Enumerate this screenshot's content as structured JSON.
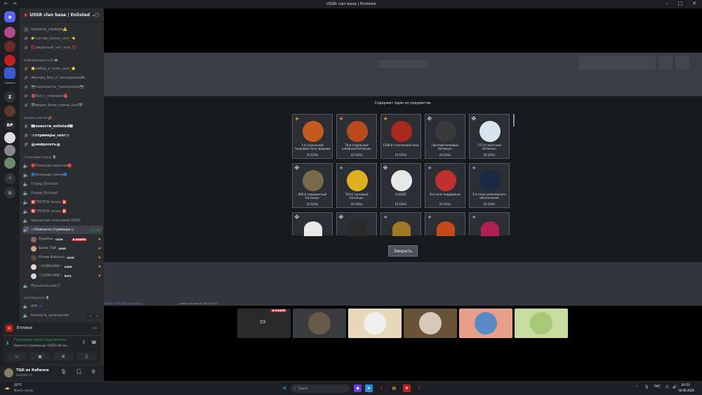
{
  "window": {
    "title": "USSR clan base | Enlisted",
    "nav": "←→"
  },
  "rail": {
    "servers_label": "Сервера"
  },
  "server": {
    "name": "USSR clan base | Enlisted"
  },
  "channels": {
    "top": [
      {
        "label": "правила_сервера⚠️"
      },
      {
        "label": "👉состав_клана_ussr_👈"
      },
      {
        "label": "🚫закрытый_чат_ussr_🚫"
      }
    ],
    "cat_info": "информационный 👁️",
    "info": [
      {
        "label": "🌟набор_в_клан_ussr_🌟"
      },
      {
        "label": "🎮инфа_бои_и_тренировки🎮"
      },
      {
        "label": "📷скриншоты_тренировок📷"
      },
      {
        "label": "📕бои_с_кланами📕"
      },
      {
        "label": "🎬видео_боев_клана_ussr🎬"
      }
    ],
    "cat_news": "всякие разное 🎉",
    "news": [
      {
        "label": "📰новости_enlisted📰"
      },
      {
        "label": "📹стримеры_ussr📹"
      },
      {
        "label": "🤖нейросеть🤖"
      }
    ],
    "cat_voice": "Голосовые Связь 🎙️",
    "voice": [
      {
        "label": "🔴Команда красная🔴"
      },
      {
        "label": "🔵Команда синяя🔵"
      },
      {
        "label": "Отряд Enlisted"
      },
      {
        "label": "Отряд Enlisted"
      },
      {
        "label": "🅰️ГРУППА точка 🅰️"
      },
      {
        "label": "🅱️ГРУППА точка 🅱️"
      },
      {
        "label": "Закрытый голосовой USSR"
      },
      {
        "label": "📹Комната стримера📹",
        "timer": "2:57:48"
      }
    ],
    "members": [
      {
        "name": "Лудобин",
        "tag": "USSR",
        "live": "В ЭФИРЕ"
      },
      {
        "name": "Бусик ТЦК",
        "tag": "USSR"
      },
      {
        "name": "Отчим Кабачка",
        "tag": "USSR"
      },
      {
        "name": "♡CHTACHOK♡",
        "tag": "USSR"
      },
      {
        "name": "♡CHTACHOK♡",
        "tag": "ROFL"
      }
    ],
    "music": "Музыкальный🎵",
    "cat_talk": "разговорная 🎙️",
    "talk": [
      {
        "label": "AFK 💤"
      },
      {
        "label": "Комната_выяснения",
        "counts": [
          "00",
          "02"
        ]
      }
    ]
  },
  "voicepanel": {
    "game": "Enlisted",
    "status": "Голосовая связь подключена",
    "location": "Комната стримера📹 / USSR clan ba..."
  },
  "user": {
    "name": "ТЦК из Кабачка",
    "status": "Enlisted +1"
  },
  "popup": {
    "title": "Содержит один из предметов:",
    "close_label": "Закрыть",
    "cards": [
      {
        "name": "1-й отдельный танковый полк прорыва",
        "pct": "(0.53%)",
        "rank": "★",
        "rank_color": "#e8a33a",
        "color": "#c45a1e"
      },
      {
        "name": "78-й отдельный сапёрный батальон",
        "pct": "(0.53%)",
        "rank": "★",
        "rank_color": "#e8a33a",
        "color": "#b84a1e"
      },
      {
        "name": "1180-й стрелковый полк",
        "pct": "(0.53%)",
        "rank": "★",
        "rank_color": "#e8a33a",
        "color": "#a8281e"
      },
      {
        "name": "противотанковый батальон",
        "pct": "(0.53%)",
        "rank": "✠",
        "rank_color": "#ffffff",
        "color": "#3a3a3a"
      },
      {
        "name": "157-й пехотный батальон",
        "pct": "(0.53%)",
        "rank": "✠",
        "rank_color": "#ffffff",
        "color": "#d8e4ee"
      },
      {
        "name": "600-й парашютный батальон",
        "pct": "(0.53%)",
        "rank": "✠",
        "rank_color": "#ffffff",
        "color": "#7a6a4a"
      },
      {
        "name": "743-й танковый батальон",
        "pct": "(0.53%)",
        "rank": "★",
        "rank_color": "#7aa6e0",
        "color": "#e0b020"
      },
      {
        "name": "III./JG26",
        "pct": "(0.53%)",
        "rank": "✠",
        "rank_color": "#ffffff",
        "color": "#e8e8e8"
      },
      {
        "name": "8-й полк поддержки",
        "pct": "(0.53%)",
        "rank": "★",
        "rank_color": "#7aa6e0",
        "color": "#c03030"
      },
      {
        "name": "2-й полк инженерного обеспечения",
        "pct": "(0.53%)",
        "rank": "★",
        "rank_color": "#7aa6e0",
        "color": "#1a2a44"
      },
      {
        "name": "",
        "pct": "",
        "rank": "✠",
        "rank_color": "#ffffff",
        "color": "#e8e8e8"
      },
      {
        "name": "",
        "pct": "",
        "rank": "✠",
        "rank_color": "#ffffff",
        "color": "#2a2a2a"
      },
      {
        "name": "",
        "pct": "",
        "rank": "★",
        "rank_color": "#7aa6e0",
        "color": "#a07828"
      },
      {
        "name": "",
        "pct": "",
        "rank": "★",
        "rank_color": "#7aa6e0",
        "color": "#c44a1e"
      },
      {
        "name": "",
        "pct": "",
        "rank": "★",
        "rank_color": "#7aa6e0",
        "color": "#b02050"
      }
    ]
  },
  "hud": {
    "status": "SRWN:11 FPS: 165.3 (4.9/-/6.5 /)",
    "latency": "Latency: 16.0ms (A: 16.1 R: 8.6)"
  },
  "stream": {
    "live_badge": "В ЭФИРЕ"
  },
  "taskbar": {
    "weather_temp": "22°C",
    "weather_desc": "Mostly cloudy",
    "search": "Поиск",
    "lang": "РУС",
    "time": "16:52",
    "date": "18.06.2026"
  },
  "colors": {
    "accent": "#5865f2",
    "online": "#23a55a",
    "live": "#da373c"
  }
}
